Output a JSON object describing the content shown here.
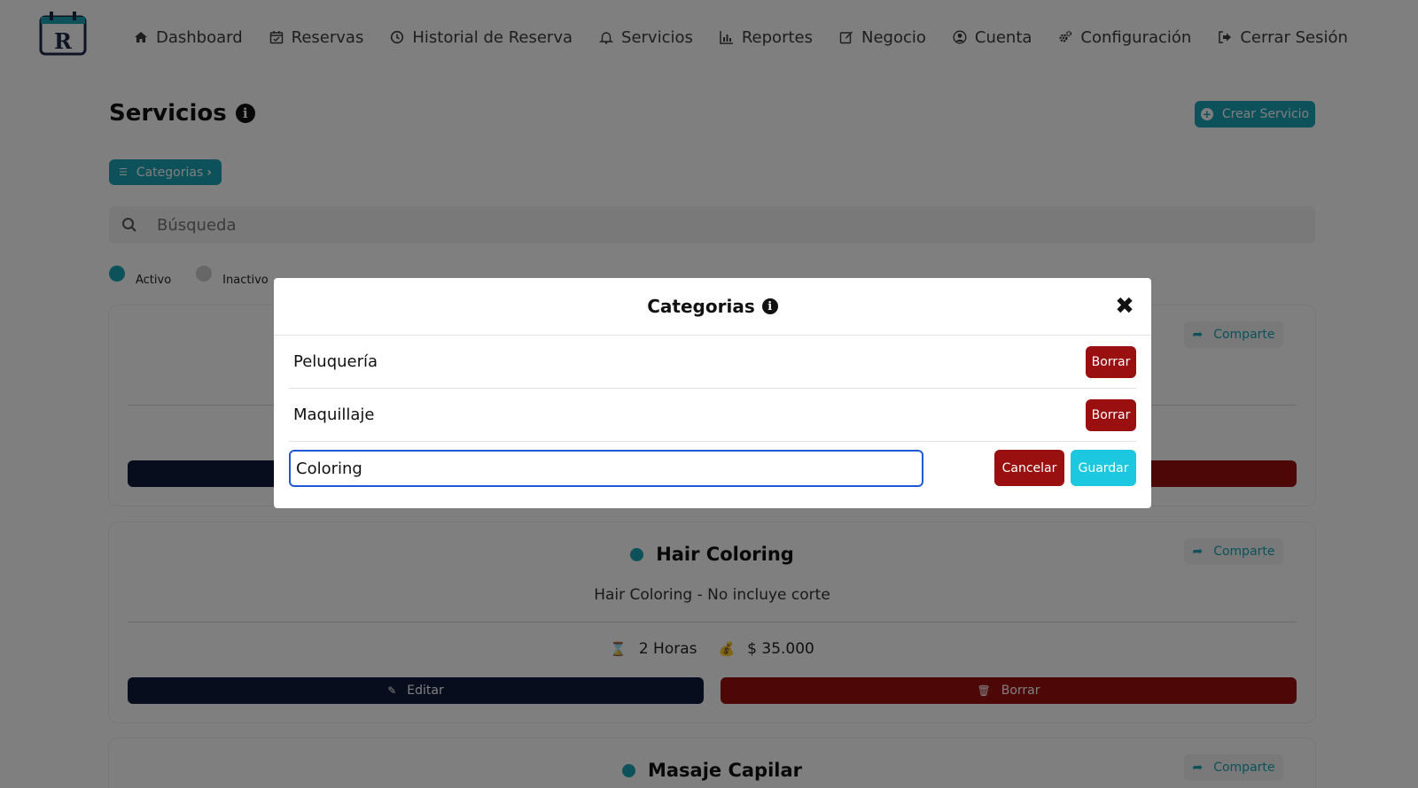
{
  "nav": {
    "items": [
      {
        "label": "Dashboard",
        "icon": "home-icon"
      },
      {
        "label": "Reservas",
        "icon": "calendar-check-icon"
      },
      {
        "label": "Historial de Reserva",
        "icon": "clock-icon"
      },
      {
        "label": "Servicios",
        "icon": "bell-icon"
      },
      {
        "label": "Reportes",
        "icon": "bar-chart-icon"
      },
      {
        "label": "Negocio",
        "icon": "edit-icon"
      },
      {
        "label": "Cuenta",
        "icon": "user-circle-icon"
      },
      {
        "label": "Configuración",
        "icon": "gears-icon"
      },
      {
        "label": "Cerrar Sesión",
        "icon": "sign-out-icon"
      }
    ]
  },
  "page": {
    "title": "Servicios",
    "create_button": "Crear Servicio",
    "categories_button": "Categorias",
    "search_placeholder": "Búsqueda",
    "legend_active": "Activo",
    "legend_inactive": "Inactivo"
  },
  "colors": {
    "accent": "#1aa3b6",
    "danger": "#9a0f0f",
    "edit": "#0f1a3a",
    "save": "#1cc7e0",
    "focus": "#1f5ad6"
  },
  "services": [
    {
      "title": "",
      "description": "",
      "duration": "",
      "price": "",
      "share_label": "Comparte",
      "edit_label": "",
      "delete_label": ""
    },
    {
      "title": "Hair Coloring",
      "description": "Hair Coloring - No incluye corte",
      "duration": "2 Horas",
      "price": "$ 35.000",
      "share_label": "Comparte",
      "edit_label": "Editar",
      "delete_label": "Borrar"
    },
    {
      "title": "Masaje Capilar",
      "share_label": "Comparte"
    }
  ],
  "modal": {
    "title": "Categorias",
    "categories": [
      {
        "name": "Peluquería",
        "delete_label": "Borrar"
      },
      {
        "name": "Maquillaje",
        "delete_label": "Borrar"
      }
    ],
    "new_category_value": "Coloring",
    "cancel_label": "Cancelar",
    "save_label": "Guardar"
  }
}
